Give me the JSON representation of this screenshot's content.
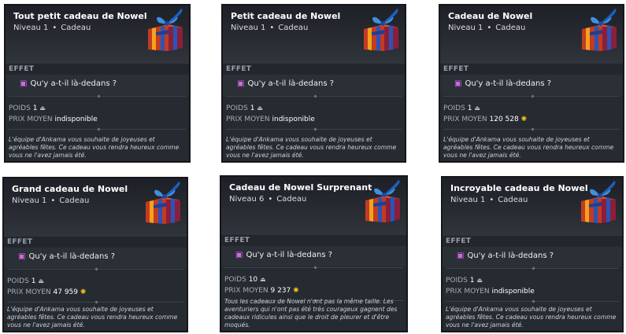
{
  "effect_label": "EFFET",
  "effect_text": "Qu'y a-t-il là-dedans ?",
  "weight_label": "POIDS",
  "price_label": "PRIX MOYEN",
  "cards": [
    {
      "title": "Tout petit cadeau de Nowel",
      "level": "Niveau 1",
      "type": "Cadeau",
      "weight": "1",
      "price": "indisponible",
      "price_has_kama": false,
      "desc": "L'équipe d'Ankama vous souhaite de joyeuses et agréables fêtes. Ce cadeau vous rendra heureux comme vous ne l'avez jamais été."
    },
    {
      "title": "Petit cadeau de Nowel",
      "level": "Niveau 1",
      "type": "Cadeau",
      "weight": "1",
      "price": "indisponible",
      "price_has_kama": false,
      "desc": "L'équipe d'Ankama vous souhaite de joyeuses et agréables fêtes. Ce cadeau vous rendra heureux comme vous ne l'avez jamais été."
    },
    {
      "title": "Cadeau de Nowel",
      "level": "Niveau 1",
      "type": "Cadeau",
      "weight": "1",
      "price": "120 528",
      "price_has_kama": true,
      "desc": "L'équipe d'Ankama vous souhaite de joyeuses et agréables fêtes. Ce cadeau vous rendra heureux comme vous ne l'avez jamais été."
    },
    {
      "title": "Grand cadeau de Nowel",
      "level": "Niveau 1",
      "type": "Cadeau",
      "weight": "1",
      "price": "47 959",
      "price_has_kama": true,
      "desc": "L'équipe d'Ankama vous souhaite de joyeuses et agréables fêtes. Ce cadeau vous rendra heureux comme vous ne l'avez jamais été."
    },
    {
      "title": "Cadeau de Nowel Surprenant",
      "level": "Niveau 6",
      "type": "Cadeau",
      "weight": "10",
      "price": "9 237",
      "price_has_kama": true,
      "desc": "Tous les cadeaux de Nowel n'ont pas la même taille. Les aventuriers qui n'ont pas été très courageux gagnent des cadeaux ridicules ainsi que le droit de pleurer et d'être moqués."
    },
    {
      "title": "Incroyable cadeau de Nowel",
      "level": "Niveau 1",
      "type": "Cadeau",
      "weight": "1",
      "price": "indisponible",
      "price_has_kama": false,
      "desc": "L'équipe d'Ankama vous souhaite de joyeuses et agréables fêtes. Ce cadeau vous rendra heureux comme vous ne l'avez jamais été."
    }
  ],
  "colors": {
    "kama": "#f2c318",
    "effect_icon": "#d268e6",
    "card_bg": "#262a31"
  },
  "icons": {
    "effect": "gift-icon",
    "weight": "weight-icon",
    "currency": "kama-icon",
    "item": "gift-box-icon"
  }
}
